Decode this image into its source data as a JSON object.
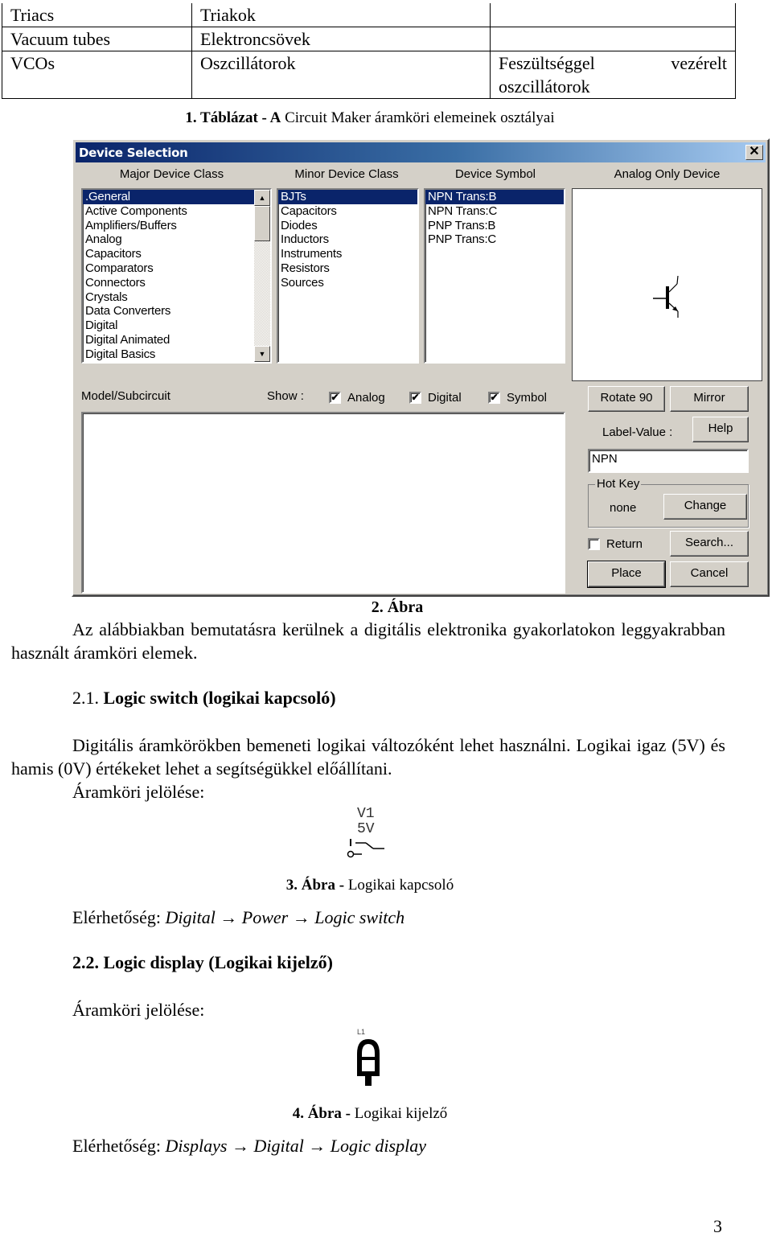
{
  "table": {
    "rows": [
      {
        "en": "Triacs",
        "hu": "Triakok",
        "desc": ""
      },
      {
        "en": "Vacuum tubes",
        "hu": "Elektroncsövek",
        "desc": ""
      },
      {
        "en": "VCOs",
        "hu": "Oszcillátorok",
        "desc_line1_a": "Feszültséggel",
        "desc_line1_b": "vezérelt",
        "desc_line2": "oszcillátorok"
      }
    ],
    "caption_bold": "1. Táblázat - A",
    "caption_rest": " Circuit Maker áramköri elemeinek osztályai"
  },
  "dialog": {
    "title": "Device Selection",
    "close_label": "✕",
    "columns": {
      "major": "Major Device Class",
      "minor": "Minor Device Class",
      "symbol": "Device Symbol",
      "analog": "Analog Only Device"
    },
    "major_items": [
      ".General",
      "Active Components",
      "Amplifiers/Buffers",
      "Analog",
      "Capacitors",
      "Comparators",
      "Connectors",
      "Crystals",
      "Data Converters",
      "Digital",
      "Digital Animated",
      "Digital Basics"
    ],
    "major_selected": ".General",
    "minor_items": [
      "BJTs",
      "Capacitors",
      "Diodes",
      "Inductors",
      "Instruments",
      "Resistors",
      "Sources"
    ],
    "minor_selected": "BJTs",
    "symbol_items": [
      "NPN Trans:B",
      "NPN Trans:C",
      "PNP Trans:B",
      "PNP Trans:C"
    ],
    "symbol_selected": "NPN Trans:B",
    "model_label": "Model/Subcircuit",
    "show_label": "Show :",
    "show_checks": [
      {
        "label": "Analog",
        "checked": true
      },
      {
        "label": "Digital",
        "checked": true
      },
      {
        "label": "Symbol",
        "checked": true
      }
    ],
    "buttons": {
      "rotate": "Rotate 90",
      "mirror": "Mirror",
      "help": "Help",
      "change": "Change",
      "search": "Search...",
      "place": "Place",
      "cancel": "Cancel"
    },
    "label_value_label": "Label-Value :",
    "label_value": "NPN",
    "hotkey_legend": "Hot Key",
    "hotkey_value": "none",
    "return_label": "Return",
    "return_checked": false,
    "check_glyph": "✔"
  },
  "fig2_caption": "2. Ábra",
  "intro_text": "Az alábbiakban bemutatásra kerülnek a digitális elektronika gyakorlatokon leggyakrabban használt áramköri elemek.",
  "sec21": {
    "num": "2.1.",
    "title": "Logic switch (logikai kapcsoló)",
    "body": "Digitális áramkörökben bemeneti logikai változóként lehet használni. Logikai igaz (5V) és hamis (0V) értékeket lehet a segítségükkel előállítani.",
    "symbol_label": "Áramköri jelölése:",
    "switch_name": "V1",
    "switch_value": "5V",
    "fig_bold": "3. Ábra -",
    "fig_rest": " Logikai kapcsoló",
    "access_label": "Elérhetőség: ",
    "access_path": "Digital → Power → Logic switch"
  },
  "sec22": {
    "num": "2.2.",
    "title": "Logic display (Logikai kijelző)",
    "symbol_label": "Áramköri jelölése:",
    "display_name": "L1",
    "fig_bold": "4. Ábra -",
    "fig_rest": " Logikai kijelző",
    "access_label": "Elérhetőség: ",
    "access_path": "Displays → Digital → Logic display"
  },
  "page_number": "3"
}
